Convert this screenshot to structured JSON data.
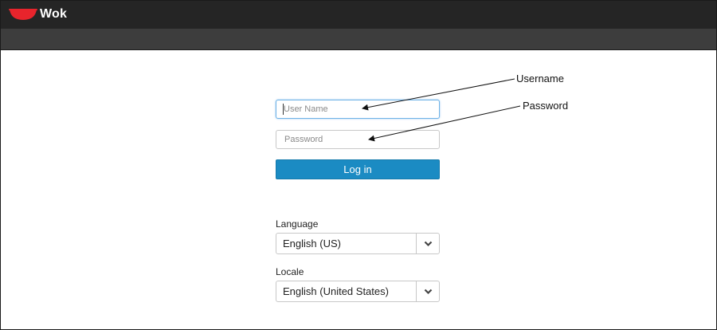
{
  "app": {
    "name": "Wok",
    "logo_icon": "red-wok-bowl-icon",
    "colors": {
      "topbar": "#252525",
      "subbar": "#3d3d3d",
      "logo": "#e8242c",
      "login_button": "#1b8bc3",
      "focus_border": "#6fb2e6"
    }
  },
  "login_form": {
    "username": {
      "placeholder": "User Name",
      "value": ""
    },
    "password": {
      "placeholder": "Password",
      "value": ""
    },
    "login_label": "Log in"
  },
  "language": {
    "label": "Language",
    "selected": "English (US)",
    "toggle_icon": "chevron-down-icon"
  },
  "locale": {
    "label": "Locale",
    "selected": "English (United States)",
    "toggle_icon": "chevron-down-icon"
  },
  "annotations": {
    "username": "Username",
    "password": "Password"
  }
}
